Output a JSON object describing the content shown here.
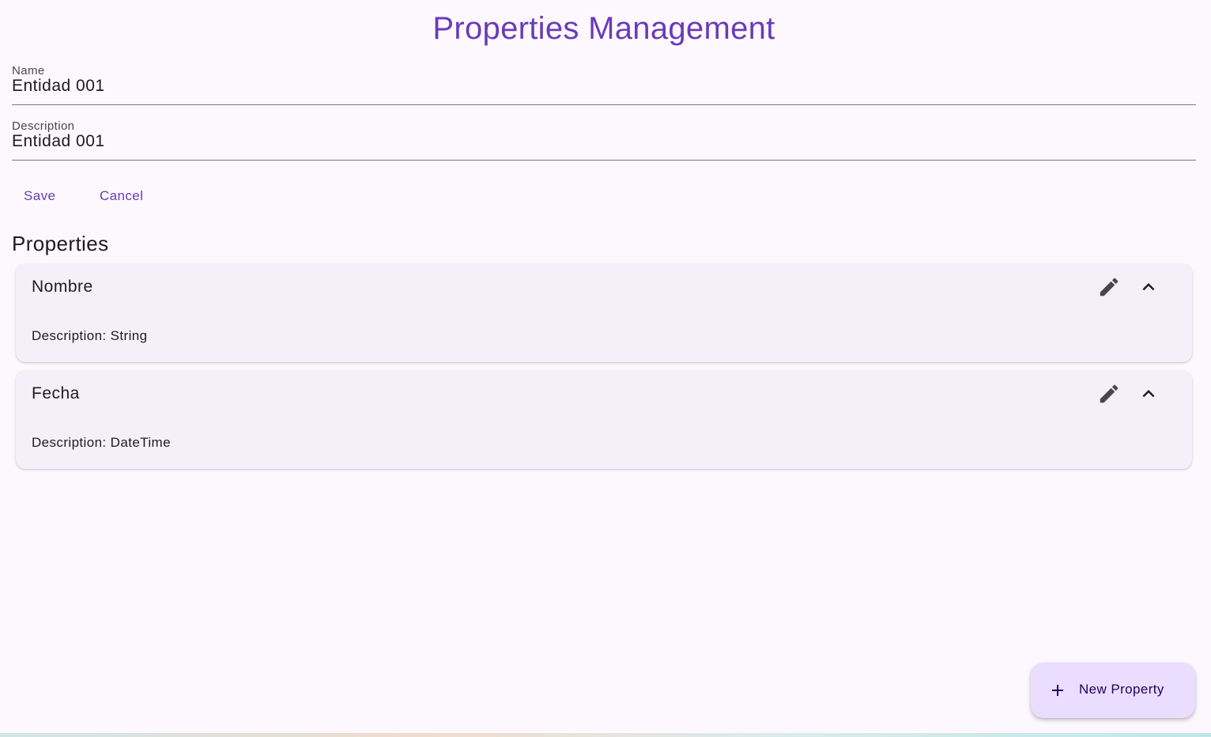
{
  "page": {
    "title": "Properties Management"
  },
  "form": {
    "name_label": "Name",
    "name_value": "Entidad 001",
    "description_label": "Description",
    "description_value": "Entidad 001"
  },
  "actions": {
    "save_label": "Save",
    "cancel_label": "Cancel"
  },
  "properties": {
    "section_title": "Properties",
    "items": [
      {
        "name": "Nombre",
        "description": "Description: String"
      },
      {
        "name": "Fecha",
        "description": "Description: DateTime"
      }
    ]
  },
  "fab": {
    "label": "New Property",
    "icon": "plus-icon"
  },
  "icons": {
    "edit": "pencil-icon",
    "collapse": "chevron-up-icon"
  },
  "colors": {
    "accent": "#6a3bb8",
    "background": "#fdf8fd",
    "card": "#f4f0f9",
    "fab": "#eaddff",
    "fab_text": "#21005d"
  }
}
